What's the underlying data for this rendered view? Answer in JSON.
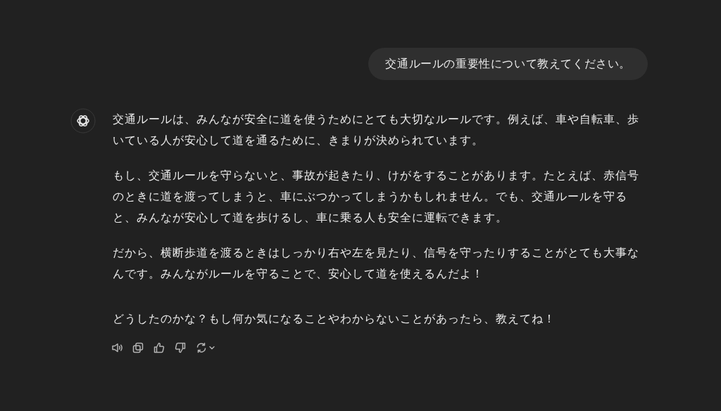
{
  "user_message": "交通ルールの重要性について教えてください。",
  "assistant": {
    "paragraphs": [
      "交通ルールは、みんなが安全に道を使うためにとても大切なルールです。例えば、車や自転車、歩いている人が安心して道を通るために、きまりが決められています。",
      "もし、交通ルールを守らないと、事故が起きたり、けがをすることがあります。たとえば、赤信号のときに道を渡ってしまうと、車にぶつかってしまうかもしれません。でも、交通ルールを守ると、みんなが安心して道を歩けるし、車に乗る人も安全に運転できます。",
      "だから、横断歩道を渡るときはしっかり右や左を見たり、信号を守ったりすることがとても大事なんです。みんながルールを守ることで、安心して道を使えるんだよ！"
    ],
    "closing": "どうしたのかな？もし何か気になることやわからないことがあったら、教えてね！"
  },
  "actions": [
    {
      "kind": "read-aloud"
    },
    {
      "kind": "copy"
    },
    {
      "kind": "thumbs-up"
    },
    {
      "kind": "thumbs-down"
    },
    {
      "kind": "regenerate"
    }
  ]
}
